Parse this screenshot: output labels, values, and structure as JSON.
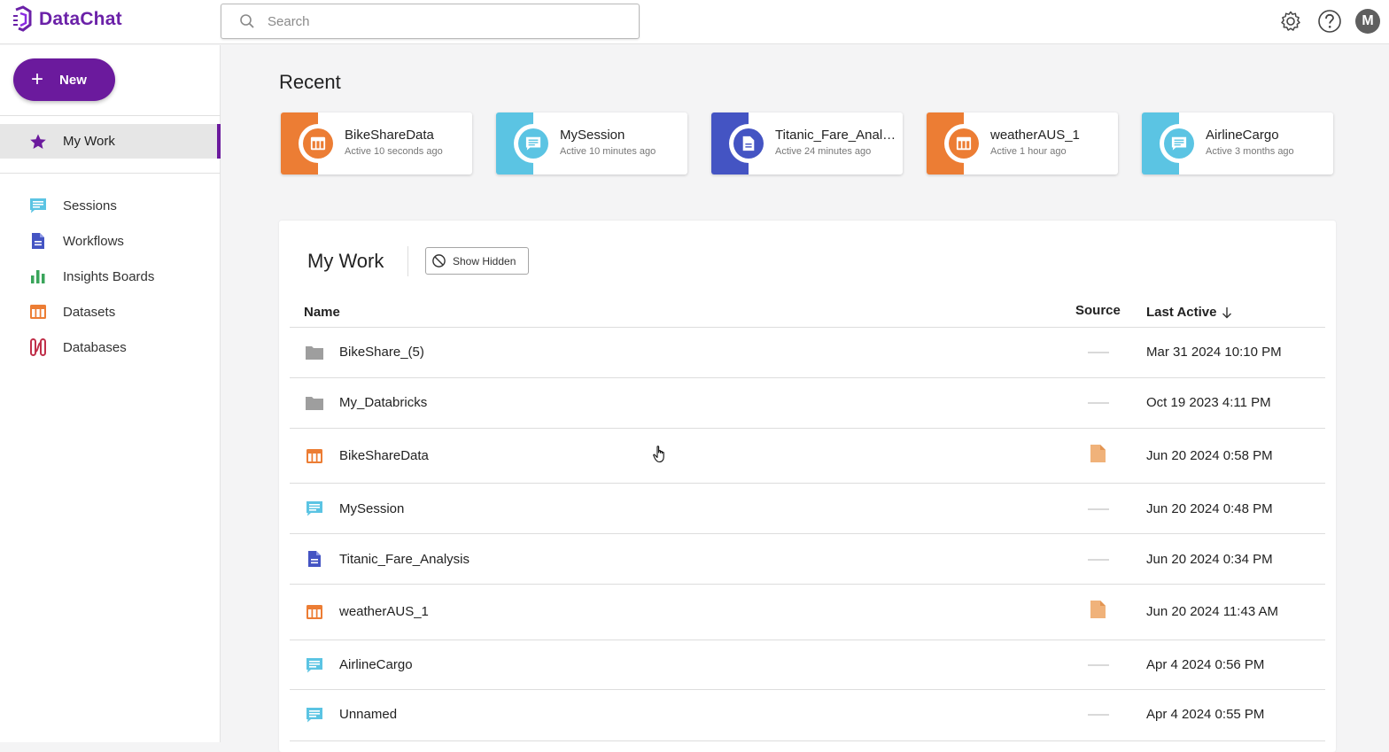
{
  "app": {
    "name": "DataChat"
  },
  "search": {
    "placeholder": "Search"
  },
  "user": {
    "initial": "M"
  },
  "sidebar": {
    "new_label": "New",
    "active_item": "My Work",
    "items": [
      {
        "label": "Sessions",
        "icon": "chat-icon",
        "color": "#5bc4e3"
      },
      {
        "label": "Workflows",
        "icon": "document-icon",
        "color": "#4454c3"
      },
      {
        "label": "Insights Boards",
        "icon": "bar-chart-icon",
        "color": "#3aa55b"
      },
      {
        "label": "Datasets",
        "icon": "table-icon",
        "color": "#ec7d34"
      },
      {
        "label": "Databases",
        "icon": "database-icon",
        "color": "#c0304a"
      }
    ]
  },
  "recent": {
    "title": "Recent",
    "cards": [
      {
        "title": "BikeShareData",
        "subtitle": "Active 10 seconds ago",
        "type": "dataset",
        "color": "#ec7d34"
      },
      {
        "title": "MySession",
        "subtitle": "Active 10 minutes ago",
        "type": "session",
        "color": "#5bc4e3"
      },
      {
        "title": "Titanic_Fare_Anal…",
        "subtitle": "Active 24 minutes ago",
        "type": "workflow",
        "color": "#4454c3"
      },
      {
        "title": "weatherAUS_1",
        "subtitle": "Active 1 hour ago",
        "type": "dataset",
        "color": "#ec7d34"
      },
      {
        "title": "AirlineCargo",
        "subtitle": "Active 3 months ago",
        "type": "session",
        "color": "#5bc4e3"
      }
    ]
  },
  "mywork": {
    "title": "My Work",
    "show_hidden_label": "Show Hidden",
    "columns": {
      "name": "Name",
      "source": "Source",
      "last_active": "Last Active"
    },
    "rows": [
      {
        "name": "BikeShare_(5)",
        "type": "folder",
        "source": "none",
        "last_active": "Mar 31 2024 10:10 PM"
      },
      {
        "name": "My_Databricks",
        "type": "folder",
        "source": "none",
        "last_active": "Oct 19 2023 4:11 PM"
      },
      {
        "name": "BikeShareData",
        "type": "dataset",
        "source": "file",
        "last_active": "Jun 20 2024 0:58 PM"
      },
      {
        "name": "MySession",
        "type": "session",
        "source": "none",
        "last_active": "Jun 20 2024 0:48 PM"
      },
      {
        "name": "Titanic_Fare_Analysis",
        "type": "workflow",
        "source": "none",
        "last_active": "Jun 20 2024 0:34 PM"
      },
      {
        "name": "weatherAUS_1",
        "type": "dataset",
        "source": "file",
        "last_active": "Jun 20 2024 11:43 AM"
      },
      {
        "name": "AirlineCargo",
        "type": "session",
        "source": "none",
        "last_active": "Apr 4 2024 0:56 PM"
      },
      {
        "name": "Unnamed",
        "type": "session",
        "source": "none",
        "last_active": "Apr 4 2024 0:55 PM"
      }
    ]
  }
}
